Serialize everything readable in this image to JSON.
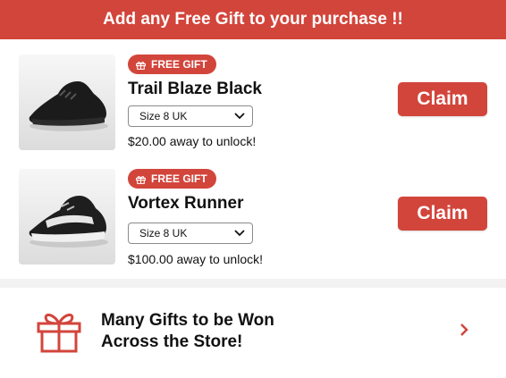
{
  "header": {
    "title": "Add any Free Gift to your purchase !!"
  },
  "items": [
    {
      "badge": "FREE GIFT",
      "name": "Trail Blaze Black",
      "size": "Size 8 UK",
      "away": "$20.00 away to unlock!",
      "claim": "Claim"
    },
    {
      "badge": "FREE GIFT",
      "name": "Vortex Runner",
      "size": "Size 8 UK",
      "away": "$100.00 away to unlock!",
      "claim": "Claim"
    }
  ],
  "promo": {
    "line1": "Many Gifts to be Won",
    "line2": "Across the Store!"
  },
  "colors": {
    "accent": "#d2453b"
  },
  "icons": {
    "badge": "gift-icon",
    "promo": "gift-icon",
    "select": "chevron-down-icon",
    "promo_arrow": "chevron-right-icon"
  }
}
